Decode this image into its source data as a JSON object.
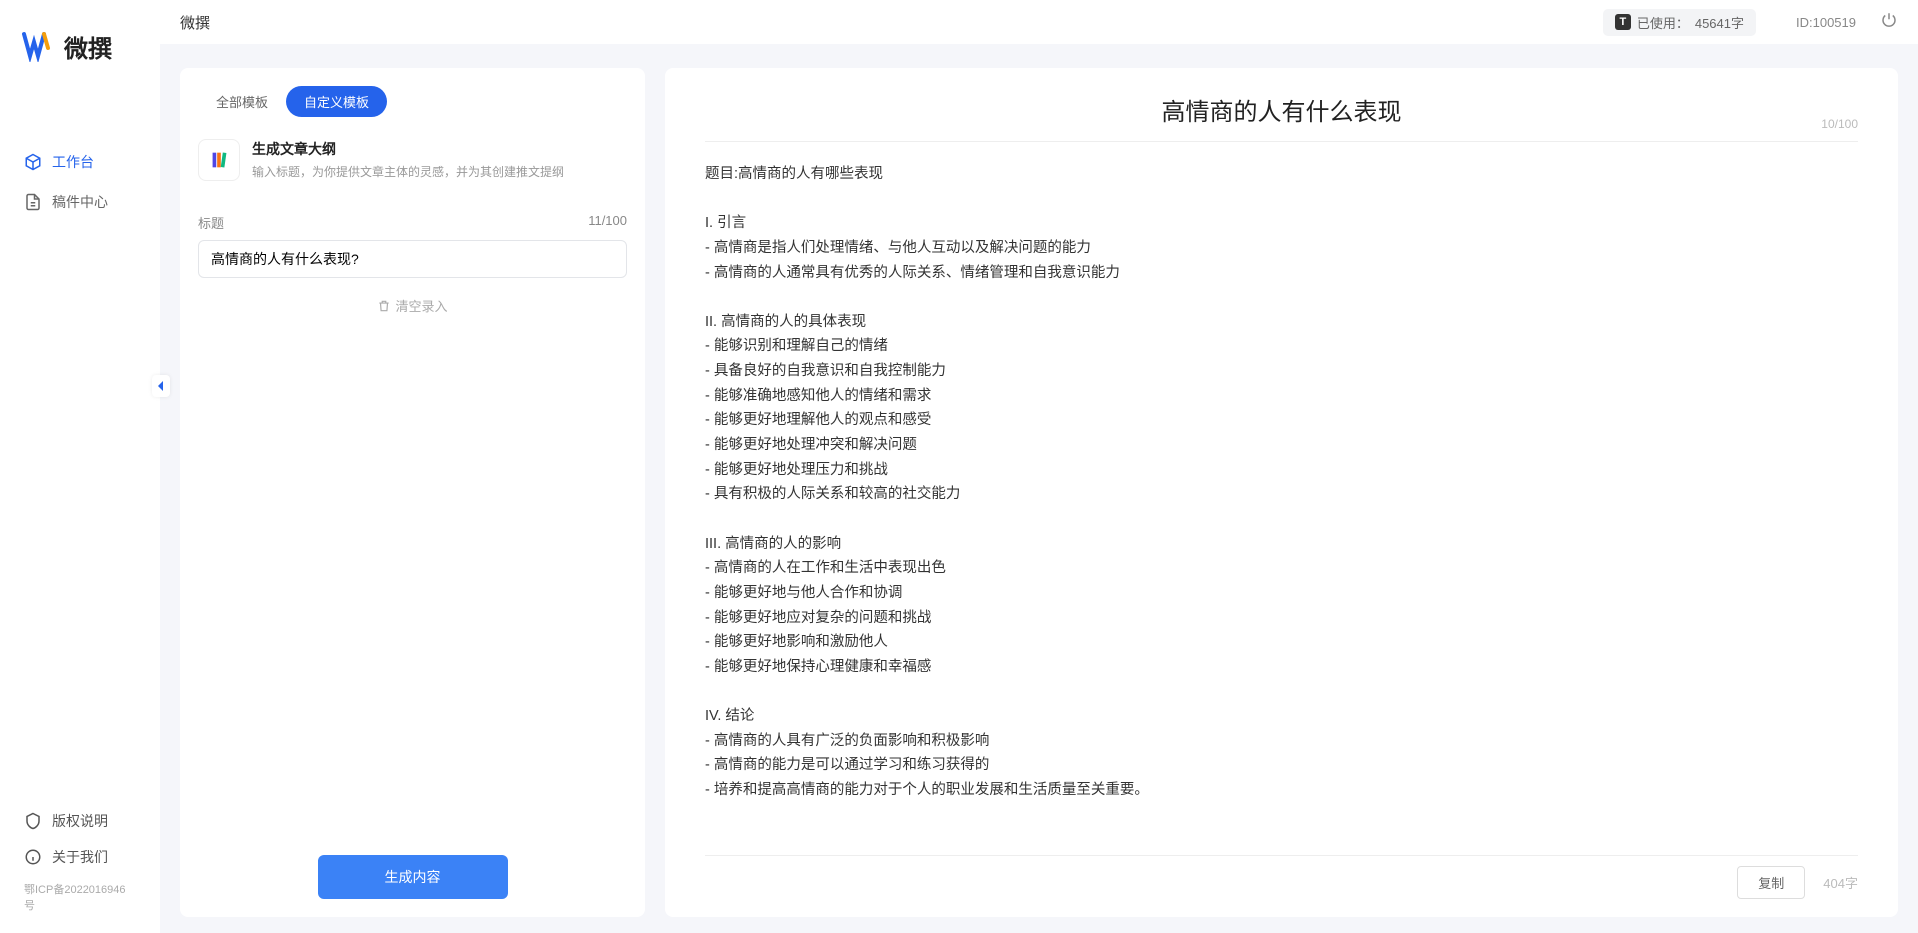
{
  "app": {
    "name": "微撰",
    "logoText": "微撰"
  },
  "header": {
    "usagePrefix": "已使用：",
    "usageValue": "45641字",
    "userId": "ID:100519"
  },
  "sidebar": {
    "items": [
      {
        "label": "工作台"
      },
      {
        "label": "稿件中心"
      }
    ],
    "footer": [
      {
        "label": "版权说明"
      },
      {
        "label": "关于我们"
      }
    ],
    "icp": "鄂ICP备2022016946号"
  },
  "leftPanel": {
    "tabs": [
      {
        "label": "全部模板"
      },
      {
        "label": "自定义模板"
      }
    ],
    "template": {
      "title": "生成文章大纲",
      "desc": "输入标题，为你提供文章主体的灵感，并为其创建推文提纲"
    },
    "form": {
      "titleLabel": "标题",
      "titleCount": "11/100",
      "titleValue": "高情商的人有什么表现?",
      "clearLabel": "清空录入"
    },
    "generateBtn": "生成内容"
  },
  "output": {
    "title": "高情商的人有什么表现",
    "charTop": "10/100",
    "body": "题目:高情商的人有哪些表现\n\nI. 引言\n- 高情商是指人们处理情绪、与他人互动以及解决问题的能力\n- 高情商的人通常具有优秀的人际关系、情绪管理和自我意识能力\n\nII. 高情商的人的具体表现\n- 能够识别和理解自己的情绪\n- 具备良好的自我意识和自我控制能力\n- 能够准确地感知他人的情绪和需求\n- 能够更好地理解他人的观点和感受\n- 能够更好地处理冲突和解决问题\n- 能够更好地处理压力和挑战\n- 具有积极的人际关系和较高的社交能力\n\nIII. 高情商的人的影响\n- 高情商的人在工作和生活中表现出色\n- 能够更好地与他人合作和协调\n- 能够更好地应对复杂的问题和挑战\n- 能够更好地影响和激励他人\n- 能够更好地保持心理健康和幸福感\n\nIV. 结论\n- 高情商的人具有广泛的负面影响和积极影响\n- 高情商的能力是可以通过学习和练习获得的\n- 培养和提高高情商的能力对于个人的职业发展和生活质量至关重要。",
    "copyBtn": "复制",
    "wordCount": "404字"
  }
}
